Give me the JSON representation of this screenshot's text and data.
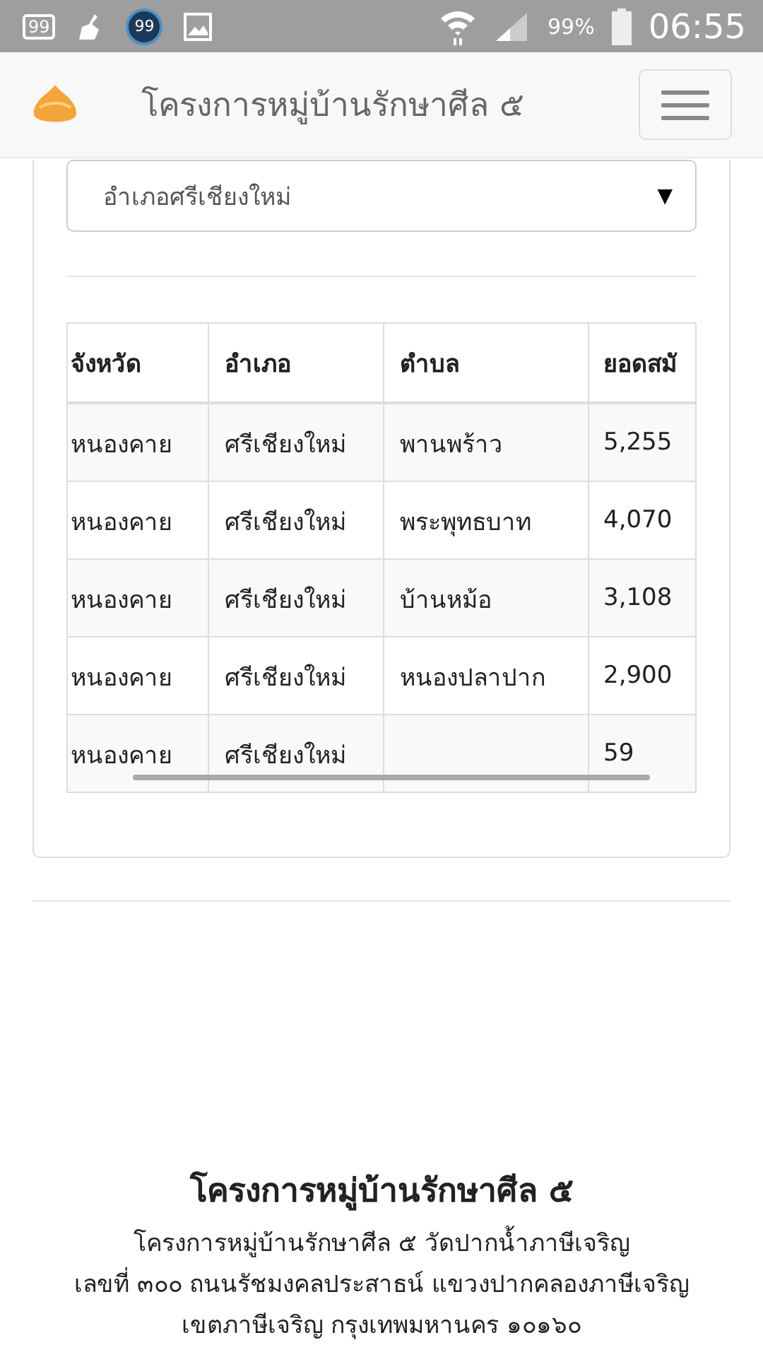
{
  "status_bar": {
    "notification_icons": [
      {
        "kind": "box",
        "text": "99"
      },
      {
        "kind": "broom"
      },
      {
        "kind": "badge",
        "text": "99"
      },
      {
        "kind": "image"
      }
    ],
    "battery_percent": "99%",
    "time": "06:55"
  },
  "navbar": {
    "title": "โครงการหมู่บ้านรักษาศีล ๕"
  },
  "filter": {
    "value": "อำเภอศรีเชียงใหม่",
    "arrow": "▼"
  },
  "table": {
    "columns": [
      "จังหวัด",
      "อำเภอ",
      "ตำบล",
      "ยอดสมั"
    ],
    "rows": [
      [
        "หนองคาย",
        "ศรีเชียงใหม่",
        "พานพร้าว",
        "5,255"
      ],
      [
        "หนองคาย",
        "ศรีเชียงใหม่",
        "พระพุทธบาท",
        "4,070"
      ],
      [
        "หนองคาย",
        "ศรีเชียงใหม่",
        "บ้านหม้อ",
        "3,108"
      ],
      [
        "หนองคาย",
        "ศรีเชียงใหม่",
        "หนองปลาปาก",
        "2,900"
      ],
      [
        "หนองคาย",
        "ศรีเชียงใหม่",
        "",
        "59"
      ]
    ]
  },
  "footer": {
    "title": "โครงการหมู่บ้านรักษาศีล ๕",
    "lines": [
      "โครงการหมู่บ้านรักษาศีล ๕ วัดปากน้ำภาษีเจริญ",
      "เลขที่ ๓๐๐ ถนนรัชมงคลประสาธน์ แขวงปากคลองภาษีเจริญ",
      "เขตภาษีเจริญ กรุงเทพมหานคร ๑๐๑๖๐"
    ]
  }
}
